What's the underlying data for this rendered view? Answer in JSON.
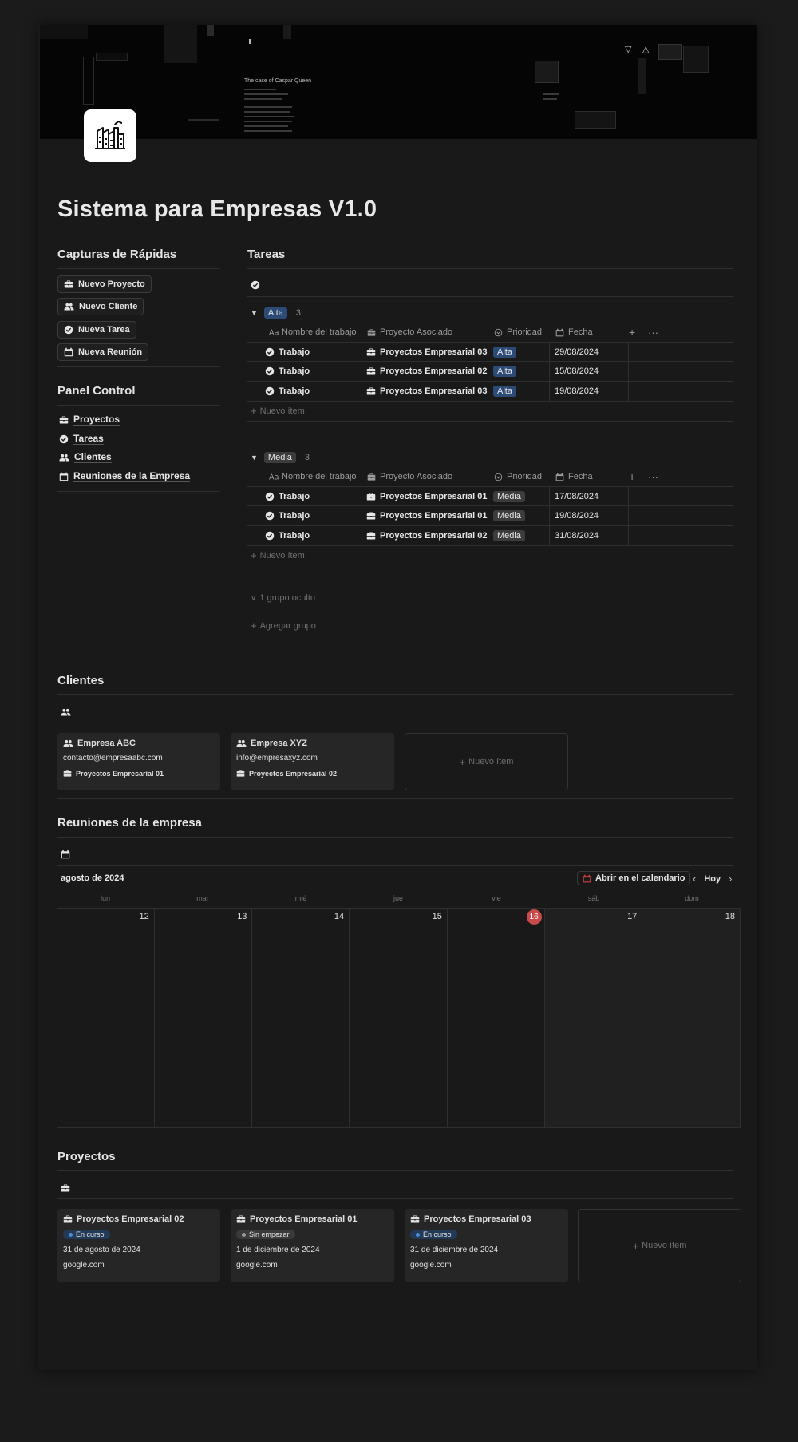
{
  "page": {
    "title": "Sistema para Empresas V1.0",
    "icon": "factory-icon"
  },
  "captures": {
    "heading": "Capturas de Rápidas",
    "buttons": [
      {
        "label": "Nuevo Proyecto",
        "icon": "briefcase-icon"
      },
      {
        "label": "Nuevo Cliente",
        "icon": "people-icon"
      },
      {
        "label": "Nueva Tarea",
        "icon": "check-circle-icon"
      },
      {
        "label": "Nueva Reunión",
        "icon": "calendar-icon"
      }
    ]
  },
  "panel": {
    "heading": "Panel Control",
    "links": [
      {
        "label": "Proyectos",
        "icon": "briefcase-icon"
      },
      {
        "label": "Tareas",
        "icon": "check-circle-icon"
      },
      {
        "label": "Clientes",
        "icon": "people-icon"
      },
      {
        "label": "Reuniones de la Empresa",
        "icon": "calendar-icon"
      }
    ]
  },
  "tareas": {
    "heading": "Tareas",
    "columns": {
      "name": "Nombre del trabajo",
      "project": "Proyecto Asociado",
      "priority": "Prioridad",
      "date": "Fecha"
    },
    "groups": [
      {
        "label": "Alta",
        "count": "3",
        "rows": [
          {
            "name": "Trabajo",
            "project": "Proyectos Empresarial 03",
            "priority": "Alta",
            "date": "29/08/2024"
          },
          {
            "name": "Trabajo",
            "project": "Proyectos Empresarial 02",
            "priority": "Alta",
            "date": "15/08/2024"
          },
          {
            "name": "Trabajo",
            "project": "Proyectos Empresarial 03",
            "priority": "Alta",
            "date": "19/08/2024"
          }
        ]
      },
      {
        "label": "Media",
        "count": "3",
        "rows": [
          {
            "name": "Trabajo",
            "project": "Proyectos Empresarial 01",
            "priority": "Media",
            "date": "17/08/2024"
          },
          {
            "name": "Trabajo",
            "project": "Proyectos Empresarial 01",
            "priority": "Media",
            "date": "19/08/2024"
          },
          {
            "name": "Trabajo",
            "project": "Proyectos Empresarial 02",
            "priority": "Media",
            "date": "31/08/2024"
          }
        ]
      }
    ],
    "new_item": "Nuevo ítem",
    "hidden_groups": "1 grupo oculto",
    "add_group": "Agregar grupo"
  },
  "clientes": {
    "heading": "Clientes",
    "cards": [
      {
        "name": "Empresa ABC",
        "email": "contacto@empresaabc.com",
        "project": "Proyectos Empresarial 01"
      },
      {
        "name": "Empresa XYZ",
        "email": "info@empresaxyz.com",
        "project": "Proyectos Empresarial 02"
      }
    ],
    "new_item": "Nuevo ítem"
  },
  "reuniones": {
    "heading": "Reuniones de la empresa",
    "month": "agosto de 2024",
    "open_calendar": "Abrir en el calendario",
    "today": "Hoy",
    "weekdays": [
      "lun",
      "mar",
      "mié",
      "jue",
      "vie",
      "sáb",
      "dom"
    ],
    "days": [
      "12",
      "13",
      "14",
      "15",
      "16",
      "17",
      "18"
    ],
    "today_day": "16"
  },
  "proyectos": {
    "heading": "Proyectos",
    "cards": [
      {
        "name": "Proyectos Empresarial 02",
        "status": "En curso",
        "date": "31 de agosto de 2024",
        "url": "google.com"
      },
      {
        "name": "Proyectos Empresarial 01",
        "status": "Sin empezar",
        "date": "1 de diciembre de 2024",
        "url": "google.com"
      },
      {
        "name": "Proyectos Empresarial 03",
        "status": "En curso",
        "date": "31 de diciembre de 2024",
        "url": "google.com"
      }
    ],
    "new_item": "Nuevo ítem"
  },
  "colors": {
    "accent_blue": "#2b4a75",
    "today_red": "#c94a4a",
    "background": "#191919"
  }
}
